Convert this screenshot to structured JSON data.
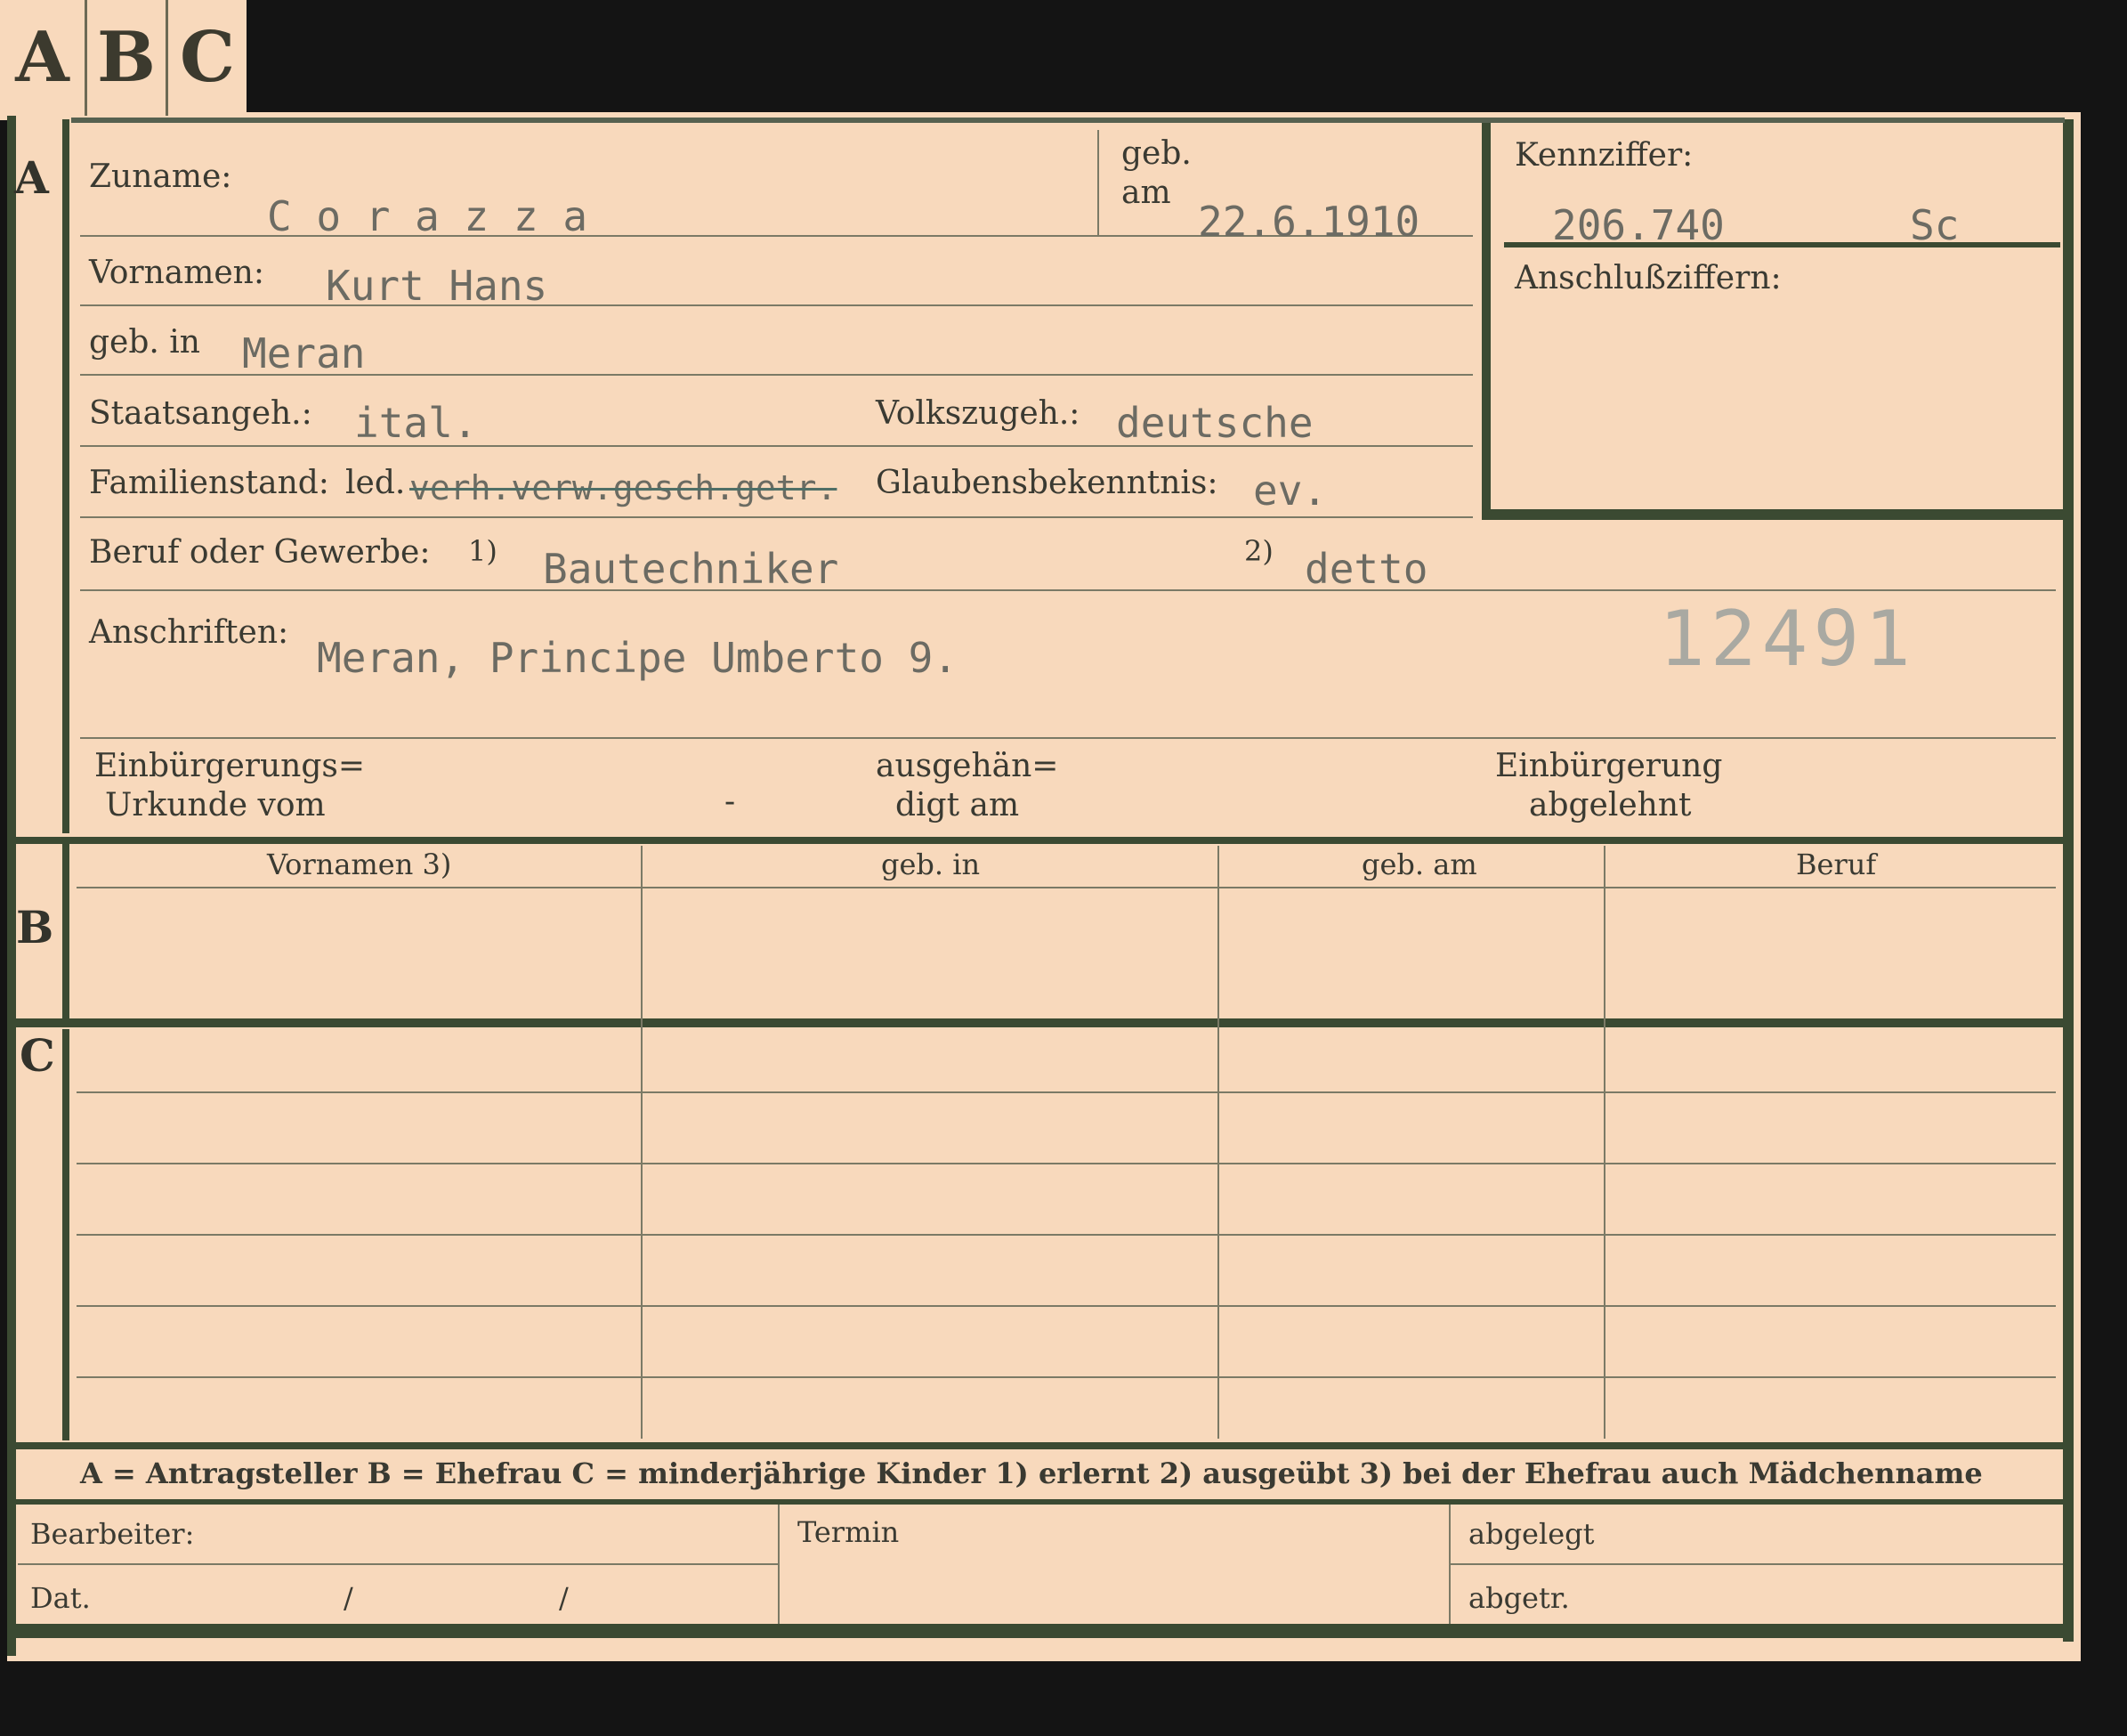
{
  "tabs": [
    "A",
    "B",
    "C"
  ],
  "sections": {
    "a": "A",
    "b": "B",
    "c": "C"
  },
  "fields": {
    "zuname_label": "Zuname:",
    "zuname_value": "C o r a z z a",
    "geb_label_1": "geb.",
    "geb_label_2": "am",
    "geb_am_value": "22.6.1910",
    "kennziffer_label": "Kennziffer:",
    "kennziffer_value": "206.740",
    "kennziffer_suffix": "Sc",
    "anschluss_label": "Anschlußziffern:",
    "vornamen_label": "Vornamen:",
    "vornamen_value": "Kurt Hans",
    "geb_in_label": "geb. in",
    "geb_in_value": "Meran",
    "staats_label": "Staatsangeh.:",
    "staats_value": "ital.",
    "volks_label": "Volkszugeh.:",
    "volks_value": "deutsche",
    "familien_label": "Familienstand:",
    "familien_prefix": "led.",
    "familien_struck": "verh.verw.gesch.getr.",
    "glaubens_label": "Glaubensbekenntnis:",
    "glaubens_value": "ev.",
    "beruf_label": "Beruf oder Gewerbe:",
    "beruf_mark_1": "1)",
    "beruf_value_1": "Bautechniker",
    "beruf_mark_2": "2)",
    "beruf_value_2": "detto",
    "anschriften_label": "Anschriften:",
    "anschriften_value": "Meran, Principe Umberto 9.",
    "stamp_number": "12491",
    "einb_urkunde_1": "Einbürgerungs=",
    "einb_urkunde_2": "Urkunde vom",
    "einb_dash": "-",
    "ausgeh_1": "ausgehän=",
    "ausgeh_2": "digt am",
    "abgelehnt_1": "Einbürgerung",
    "abgelehnt_2": "abgelehnt"
  },
  "table_headers": [
    "Vornamen 3)",
    "geb. in",
    "geb. am",
    "Beruf"
  ],
  "legend": "A = Antragsteller   B = Ehefrau   C = minderjährige Kinder   1) erlernt   2) ausgeübt   3) bei der Ehefrau auch Mädchenname",
  "footer": {
    "bearbeiter": "Bearbeiter:",
    "termin": "Termin",
    "abgelegt": "abgelegt",
    "dat": "Dat.",
    "slash1": "/",
    "slash2": "/",
    "abgetr": "abgetr."
  }
}
